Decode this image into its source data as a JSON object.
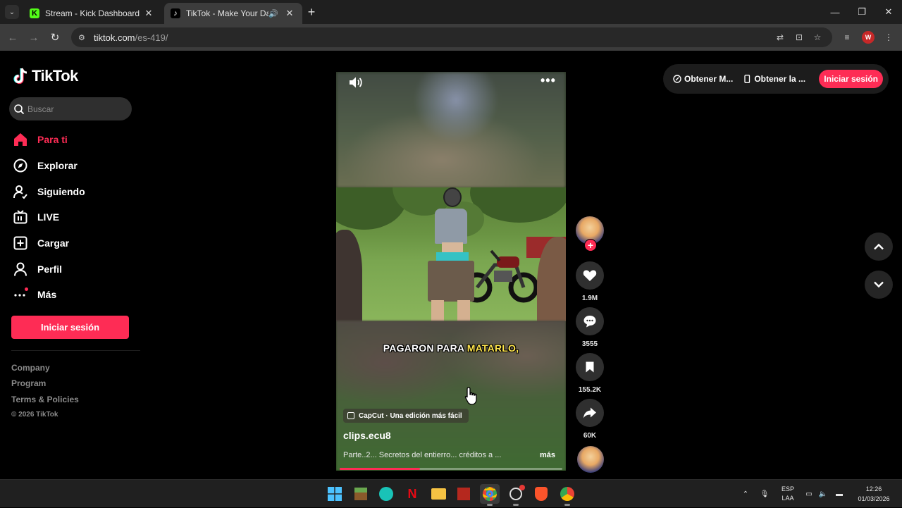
{
  "browser": {
    "tabs": [
      {
        "title": "Stream - Kick Dashboard",
        "active": false
      },
      {
        "title": "TikTok - Make Your Day",
        "active": true
      }
    ],
    "url_host": "tiktok.com",
    "url_path": "/es-419/",
    "profile_initial": "W"
  },
  "sidebar": {
    "logo_text": "TikTok",
    "search_placeholder": "Buscar",
    "nav": [
      {
        "label": "Para ti",
        "icon": "home-icon",
        "active": true
      },
      {
        "label": "Explorar",
        "icon": "compass-icon"
      },
      {
        "label": "Siguiendo",
        "icon": "following-icon"
      },
      {
        "label": "LIVE",
        "icon": "live-icon"
      },
      {
        "label": "Cargar",
        "icon": "upload-icon"
      },
      {
        "label": "Perfil",
        "icon": "profile-icon"
      },
      {
        "label": "Más",
        "icon": "more-icon"
      }
    ],
    "login_button": "Iniciar sesión",
    "footer_links": [
      "Company",
      "Program",
      "Terms & Policies"
    ],
    "copyright": "© 2026 TikTok"
  },
  "header": {
    "get_app_1": "Obtener M...",
    "get_app_2": "Obtener la ...",
    "login_button": "Iniciar sesión"
  },
  "video": {
    "caption_white": "PAGARON PARA ",
    "caption_highlight": "MATARLO,",
    "capcut_label": "CapCut · Una edición más fácil",
    "author": "clips.ecu8",
    "description": "Parte..2... Secretos del entierro... créditos a ...",
    "more_label": "más",
    "progress": 0.36
  },
  "actions": {
    "likes": "1.9M",
    "comments": "3555",
    "saves": "155.2K",
    "shares": "60K"
  },
  "taskbar": {
    "lang_line1": "ESP",
    "lang_line2": "LAA",
    "time": "12:26",
    "date": "01/03/2026"
  },
  "colors": {
    "accent": "#fe2c55",
    "background": "#000000"
  }
}
